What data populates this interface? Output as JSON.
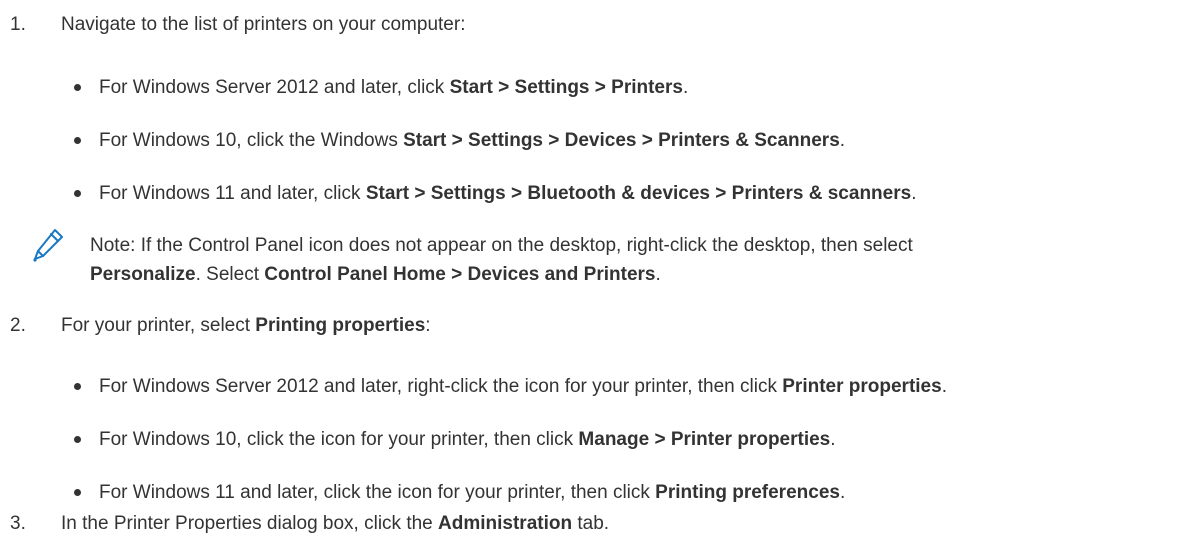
{
  "steps": [
    {
      "number": "1.",
      "text": "Navigate to the list of printers on your computer:",
      "bullets": [
        {
          "pre": "For Windows Server 2012 and later, click ",
          "bold": "Start > Settings > Printers",
          "post": "."
        },
        {
          "pre": "For Windows 10, click the Windows ",
          "bold": "Start > Settings > Devices > Printers & Scanners",
          "post": "."
        },
        {
          "pre": "For Windows 11 and later, click ",
          "bold": "Start > Settings > Bluetooth & devices > Printers & scanners",
          "post": "."
        }
      ],
      "note": {
        "icon": "pencil-icon",
        "line1": "Note: If the Control Panel icon does not appear on the desktop, right-click the desktop, then select",
        "line2_bold1": "Personalize",
        "line2_mid": ". Select ",
        "line2_bold2": "Control Panel Home > Devices and Printers",
        "line2_post": "."
      }
    },
    {
      "number": "2.",
      "pre": "For your printer, select ",
      "bold": "Printing properties",
      "post": ":",
      "bullets": [
        {
          "pre": "For Windows Server 2012 and later, right-click the icon for your printer, then click ",
          "bold": "Printer properties",
          "post": "."
        },
        {
          "pre": "For Windows 10, click the icon for your printer, then click ",
          "bold": "Manage > Printer properties",
          "post": "."
        },
        {
          "pre": "For Windows 11 and later, click the icon for your printer, then click ",
          "bold": "Printing preferences",
          "post": "."
        }
      ]
    },
    {
      "number": "3.",
      "pre": "In the Printer Properties dialog box, click the ",
      "bold": "Administration",
      "post": " tab."
    }
  ],
  "colors": {
    "text": "#333333",
    "icon": "#1a78c2"
  }
}
